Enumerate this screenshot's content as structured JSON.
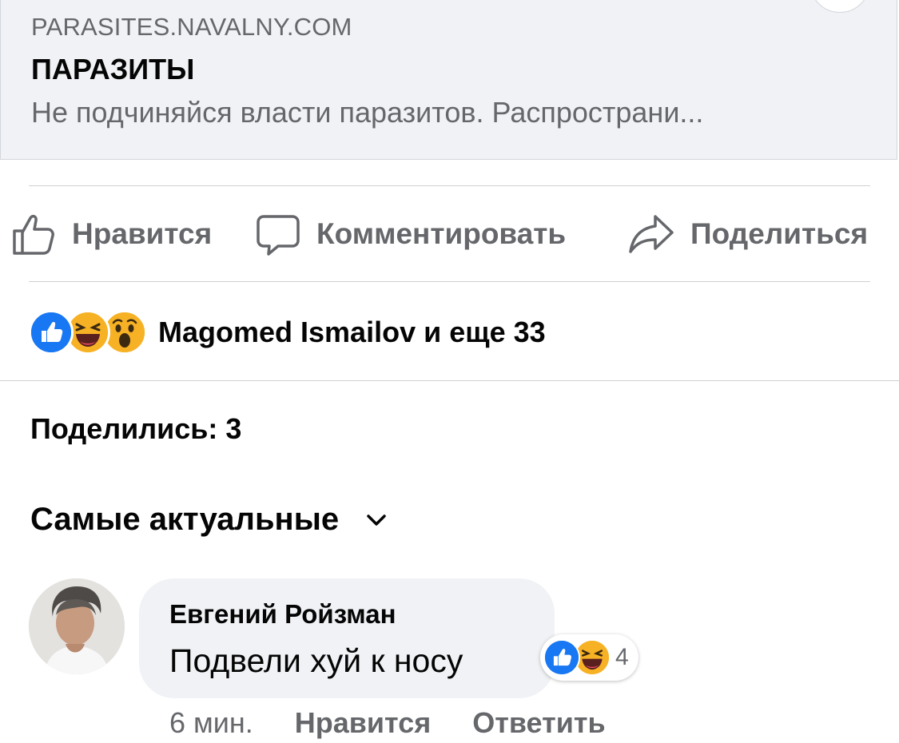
{
  "link_preview": {
    "domain": "PARASITES.NAVALNY.COM",
    "title": "ПАРАЗИТЫ",
    "description": "Не подчиняйся власти паразитов. Распространи..."
  },
  "actions": {
    "like": "Нравится",
    "comment": "Комментировать",
    "share": "Поделиться"
  },
  "reactions": {
    "icons": [
      "like-icon",
      "haha-icon",
      "wow-icon"
    ],
    "summary": "Magomed Ismailov и еще 33"
  },
  "shares": "Поделились: 3",
  "comments_sort": {
    "selected": "Самые актуальные"
  },
  "comment": {
    "author": "Евгений Ройзман",
    "text": "Подвели хуй к носу",
    "reaction_icons": [
      "like-icon",
      "haha-icon"
    ],
    "reaction_count": "4",
    "time": "6 мин.",
    "like_label": "Нравится",
    "reply_label": "Ответить"
  },
  "colors": {
    "text_primary": "#050505",
    "text_secondary": "#65676b",
    "card_background": "#f0f2f5",
    "like_blue": "#1877f2",
    "emoji_yellow": "#f7b125"
  }
}
